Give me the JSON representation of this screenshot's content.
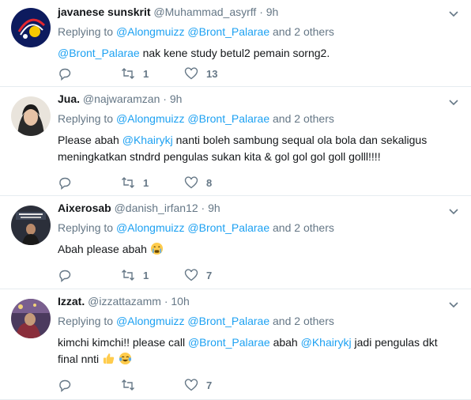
{
  "tweets": [
    {
      "name": "javanese sunskrit",
      "handle": "@Muhammad_asyrff",
      "dot": "·",
      "time": "9h",
      "replying_prefix": "Replying to",
      "reply_mentions": [
        "@Alongmuizz",
        "@Bront_Palarae"
      ],
      "reply_suffix": "and 2 others",
      "text_mention": "@Bront_Palarae",
      "text": "nak kene study betul2 pemain sorng2.",
      "retweets": "1",
      "likes": "13"
    },
    {
      "name": "Jua.",
      "handle": "@najwaramzan",
      "dot": "·",
      "time": "9h",
      "replying_prefix": "Replying to",
      "reply_mentions": [
        "@Alongmuizz",
        "@Bront_Palarae"
      ],
      "reply_suffix": "and 2 others",
      "text_a": "Please abah",
      "text_mention": "@Khairykj",
      "text_b": "nanti boleh sambung sequal ola bola dan sekaligus meningkatkan stndrd pengulas sukan kita & gol gol gol goll golll!!!!",
      "retweets": "1",
      "likes": "8"
    },
    {
      "name": "Aixerosab",
      "handle": "@danish_irfan12",
      "dot": "·",
      "time": "9h",
      "replying_prefix": "Replying to",
      "reply_mentions": [
        "@Alongmuizz",
        "@Bront_Palarae"
      ],
      "reply_suffix": "and 2 others",
      "text": "Abah please abah",
      "emoji": "crying-face",
      "retweets": "1",
      "likes": "7"
    },
    {
      "name": "Izzat.",
      "handle": "@izzattazamm",
      "dot": "·",
      "time": "10h",
      "replying_prefix": "Replying to",
      "reply_mentions": [
        "@Alongmuizz",
        "@Bront_Palarae"
      ],
      "reply_suffix": "and 2 others",
      "text_a": "kimchi kimchi!! please call",
      "text_mention_1": "@Bront_Palarae",
      "text_b": "abah",
      "text_mention_2": "@Khairykj",
      "text_c": "jadi pengulas dkt final nnti",
      "emojis": [
        "thumbs-up",
        "tears-of-joy"
      ],
      "retweets": "",
      "likes": "7"
    }
  ],
  "colors": {
    "link": "#1da1f2",
    "muted": "#657786",
    "text": "#14171a",
    "border": "#e6ecf0"
  }
}
